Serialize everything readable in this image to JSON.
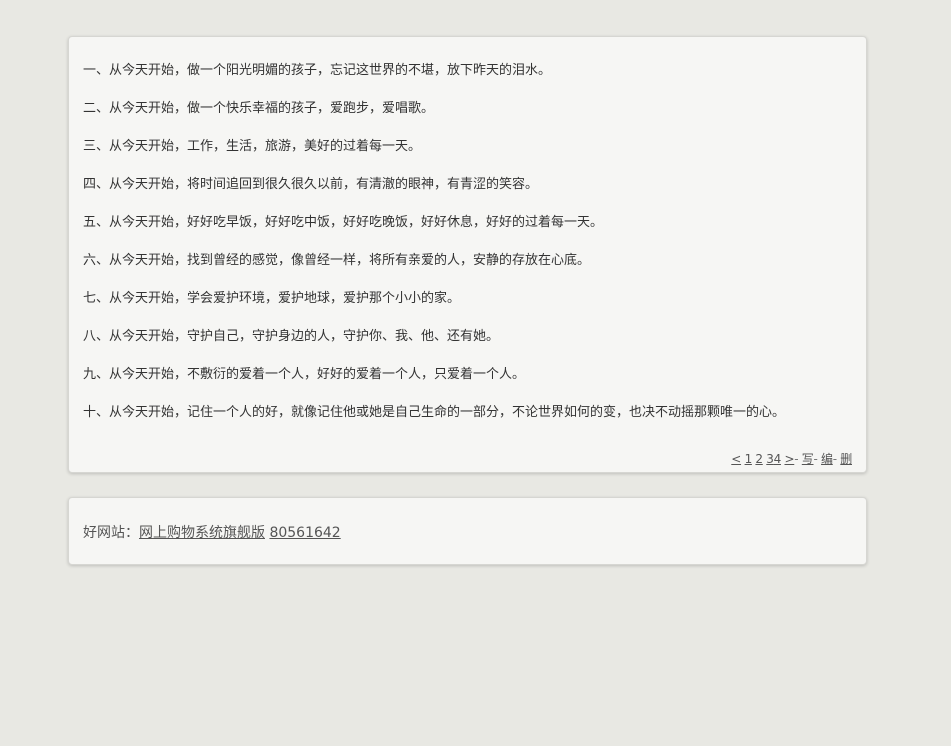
{
  "main": {
    "lines": [
      "一、从今天开始，做一个阳光明媚的孩子，忘记这世界的不堪，放下昨天的泪水。",
      "二、从今天开始，做一个快乐幸福的孩子，爱跑步，爱唱歌。",
      "三、从今天开始，工作，生活，旅游，美好的过着每一天。",
      "四、从今天开始，将时间追回到很久很久以前，有清澈的眼神，有青涩的笑容。",
      "五、从今天开始，好好吃早饭，好好吃中饭，好好吃晚饭，好好休息，好好的过着每一天。",
      "六、从今天开始，找到曾经的感觉，像曾经一样，将所有亲爱的人，安静的存放在心底。",
      "七、从今天开始，学会爱护环境，爱护地球，爱护那个小小的家。",
      "八、从今天开始，守护自己，守护身边的人，守护你、我、他、还有她。",
      "九、从今天开始，不敷衍的爱着一个人，好好的爱着一个人，只爱着一个人。",
      "十、从今天开始，记住一个人的好，就像记住他或她是自己生命的一部分，不论世界如何的变，也决不动摇那颗唯一的心。"
    ],
    "pager": {
      "prev": "<",
      "page1": "1",
      "page2": "2",
      "page3": "3",
      "page4": "4",
      "next": ">",
      "write": "写",
      "edit": "编",
      "delete": "删",
      "separator": "-"
    }
  },
  "footer_links": {
    "label": "好网站：",
    "link1": "网上购物系统旗舰版",
    "link2": "80561642"
  }
}
